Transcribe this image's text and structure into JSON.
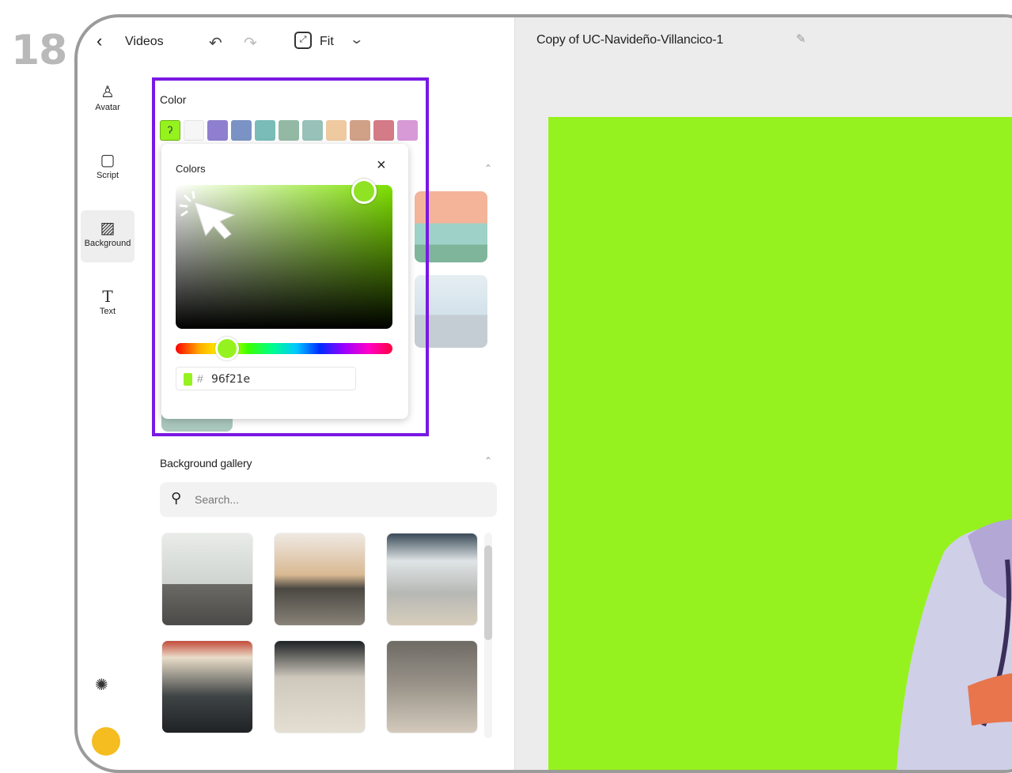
{
  "step_number": "18",
  "topbar": {
    "back_label": "Videos",
    "fit_label": "Fit"
  },
  "nav": {
    "avatar": "Avatar",
    "script": "Script",
    "background": "Background",
    "text": "Text"
  },
  "color_section": {
    "label": "Color",
    "swatches": [
      "#96f21e",
      "#f6f6f6",
      "#8f7fcf",
      "#7a93c4",
      "#79bcb8",
      "#93b9a4",
      "#97c1b9",
      "#efc9a0",
      "#d0a087",
      "#d37b87",
      "#d79ad6"
    ]
  },
  "color_picker": {
    "title": "Colors",
    "close": "×",
    "hash": "#",
    "hex_value": "96f21e",
    "selected_color": "#96f21e"
  },
  "gallery": {
    "title": "Background gallery",
    "search_placeholder": "Search..."
  },
  "canvas": {
    "project_title": "Copy of UC-Navideño-Villancico-1",
    "background_color": "#96f21e"
  },
  "accent": {
    "highlight_border": "#7a18e3"
  }
}
